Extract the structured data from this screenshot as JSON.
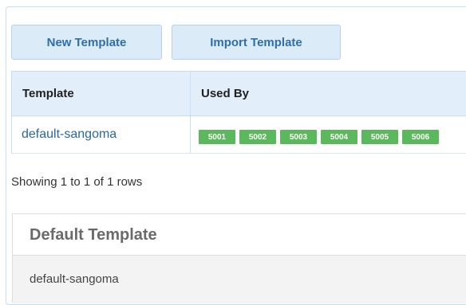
{
  "toolbar": {
    "new_template_label": "New Template",
    "import_template_label": "Import Template"
  },
  "table": {
    "columns": [
      "Template",
      "Used By"
    ],
    "rows": [
      {
        "template": "default-sangoma",
        "used_by": [
          "5001",
          "5002",
          "5003",
          "5004",
          "5005",
          "5006"
        ]
      }
    ]
  },
  "pagination": {
    "text": "Showing 1 to 1 of 1 rows"
  },
  "default_template": {
    "title": "Default Template",
    "value": "default-sangoma"
  },
  "colors": {
    "accent": "#2e6fa6",
    "button_bg": "#dcebf8",
    "header_bg": "#e2effb",
    "tag_green": "#5cb85c"
  }
}
